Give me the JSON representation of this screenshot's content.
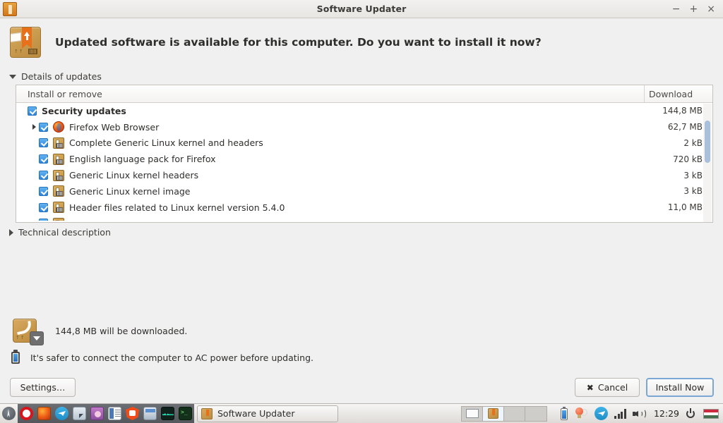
{
  "window": {
    "title": "Software Updater",
    "icon": "package-icon",
    "controls": {
      "minimize": "−",
      "maximize": "+",
      "close": "×"
    }
  },
  "header": {
    "icon": "software-updater-package-icon",
    "message": "Updated software is available for this computer. Do you want to install it now?"
  },
  "details_expander": {
    "label": "Details of updates",
    "expanded": true
  },
  "tech_expander": {
    "label": "Technical description",
    "expanded": false
  },
  "list": {
    "columns": {
      "name": "Install or remove",
      "download": "Download"
    },
    "rows": [
      {
        "label": "Security updates",
        "size": "144,8 MB",
        "level": 0,
        "group": true,
        "checked": true,
        "icon": null,
        "expander": false
      },
      {
        "label": "Firefox Web Browser",
        "size": "62,7 MB",
        "level": 1,
        "group": false,
        "checked": true,
        "icon": "firefox-icon",
        "expander": true
      },
      {
        "label": "Complete Generic Linux kernel and headers",
        "size": "2 kB",
        "level": 1,
        "group": false,
        "checked": true,
        "icon": "deb-package-icon",
        "expander": false
      },
      {
        "label": "English language pack for Firefox",
        "size": "720 kB",
        "level": 1,
        "group": false,
        "checked": true,
        "icon": "deb-package-icon",
        "expander": false
      },
      {
        "label": "Generic Linux kernel headers",
        "size": "3 kB",
        "level": 1,
        "group": false,
        "checked": true,
        "icon": "deb-package-icon",
        "expander": false
      },
      {
        "label": "Generic Linux kernel image",
        "size": "3 kB",
        "level": 1,
        "group": false,
        "checked": true,
        "icon": "deb-package-icon",
        "expander": false
      },
      {
        "label": "Header files related to Linux kernel version 5.4.0",
        "size": "11,0 MB",
        "level": 1,
        "group": false,
        "checked": true,
        "icon": "deb-package-icon",
        "expander": false
      }
    ]
  },
  "summary": {
    "download_icon": "download-package-icon",
    "download_text": "144,8 MB will be downloaded.",
    "power_icon": "battery-icon",
    "power_text": "It's safer to connect the computer to AC power before updating."
  },
  "buttons": {
    "settings": "Settings…",
    "cancel": "Cancel",
    "cancel_icon": "✖",
    "install": "Install Now"
  },
  "taskbar": {
    "launchers": [
      {
        "name": "applications-menu-icon"
      },
      {
        "name": "opera-icon"
      },
      {
        "name": "firefox-icon"
      },
      {
        "name": "telegram-icon"
      },
      {
        "name": "file-manager-icon"
      },
      {
        "name": "media-player-icon"
      },
      {
        "name": "text-editor-icon"
      },
      {
        "name": "brave-browser-icon"
      },
      {
        "name": "calculator-icon"
      },
      {
        "name": "system-monitor-icon"
      },
      {
        "name": "terminal-icon"
      }
    ],
    "window_button": {
      "label": "Software Updater",
      "icon": "package-icon"
    },
    "tray": {
      "clock": "12:29",
      "battery_icon": "battery-icon",
      "notification_icon": "notification-bulb-icon",
      "telegram_icon": "telegram-tray-icon",
      "network_icon": "signal-bars-icon",
      "volume_icon": "volume-icon",
      "power_icon": "power-icon",
      "keyboard_layout_icon": "hungary-flag-icon"
    }
  },
  "colors": {
    "accent": "#2e84d8",
    "package_orange": "#e8701a",
    "window_bg": "#f0f0f0",
    "focus_border": "#7aa7d4"
  }
}
